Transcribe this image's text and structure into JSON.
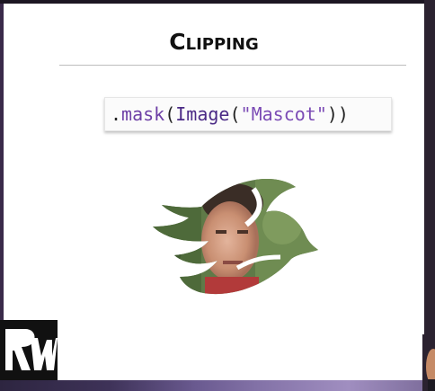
{
  "slide": {
    "title": "Clipping",
    "code": {
      "dot": ".",
      "method": "mask",
      "open_paren": "(",
      "type": "Image",
      "open_paren2": "(",
      "string": "\"Mascot\"",
      "close": "))"
    }
  },
  "icons": {
    "mascot": "mascot-bird-silhouette",
    "logo": "rw-logo"
  }
}
